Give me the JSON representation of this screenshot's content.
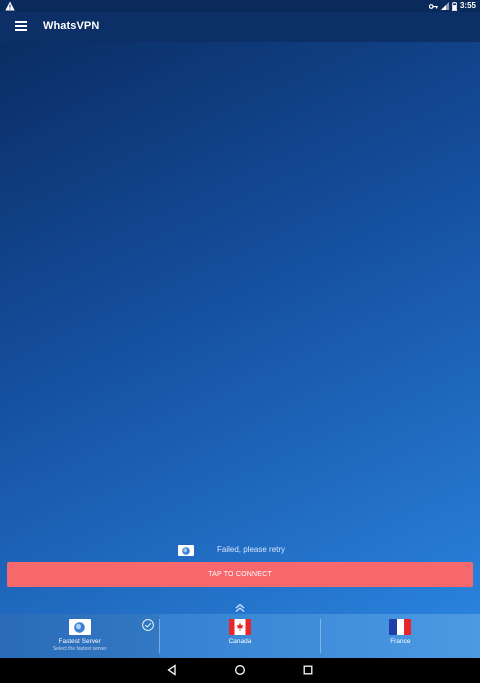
{
  "status_bar": {
    "time": "3:55"
  },
  "app_bar": {
    "title": "WhatsVPN"
  },
  "connection": {
    "status_text": "Failed, please retry",
    "connect_label": "TAP TO CONNECT"
  },
  "servers": [
    {
      "name": "Fastest Server",
      "subtitle": "Select the fastest server",
      "flag_icon": "globe-icon",
      "selected": true
    },
    {
      "name": "Canada",
      "flag_icon": "canada-flag-icon"
    },
    {
      "name": "France",
      "flag_icon": "france-flag-icon"
    }
  ],
  "colors": {
    "connect_button": "#f6686c",
    "app_bar": "#0b2f66",
    "accent_blue": "#2a82dc"
  }
}
